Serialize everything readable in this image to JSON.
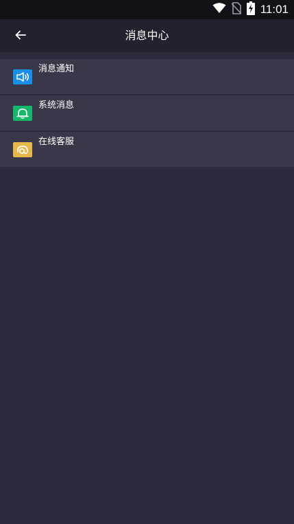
{
  "status_bar": {
    "time": "11:01",
    "icons": [
      "wifi-icon",
      "no-sim-icon",
      "battery-charging-icon"
    ]
  },
  "app_bar": {
    "title": "消息中心",
    "back_icon": "arrow-left-icon"
  },
  "list": {
    "items": [
      {
        "label": "消息通知",
        "icon": "megaphone-icon",
        "icon_color": "#1a8fe6"
      },
      {
        "label": "系统消息",
        "icon": "bell-icon",
        "icon_color": "#15b86a"
      },
      {
        "label": "在线客服",
        "icon": "headset-icon",
        "icon_color": "#e6b84a"
      }
    ]
  },
  "colors": {
    "background": "#2a2a3b",
    "status_bar": "#121218",
    "app_bar": "#22222f",
    "list_item": "#393849"
  }
}
